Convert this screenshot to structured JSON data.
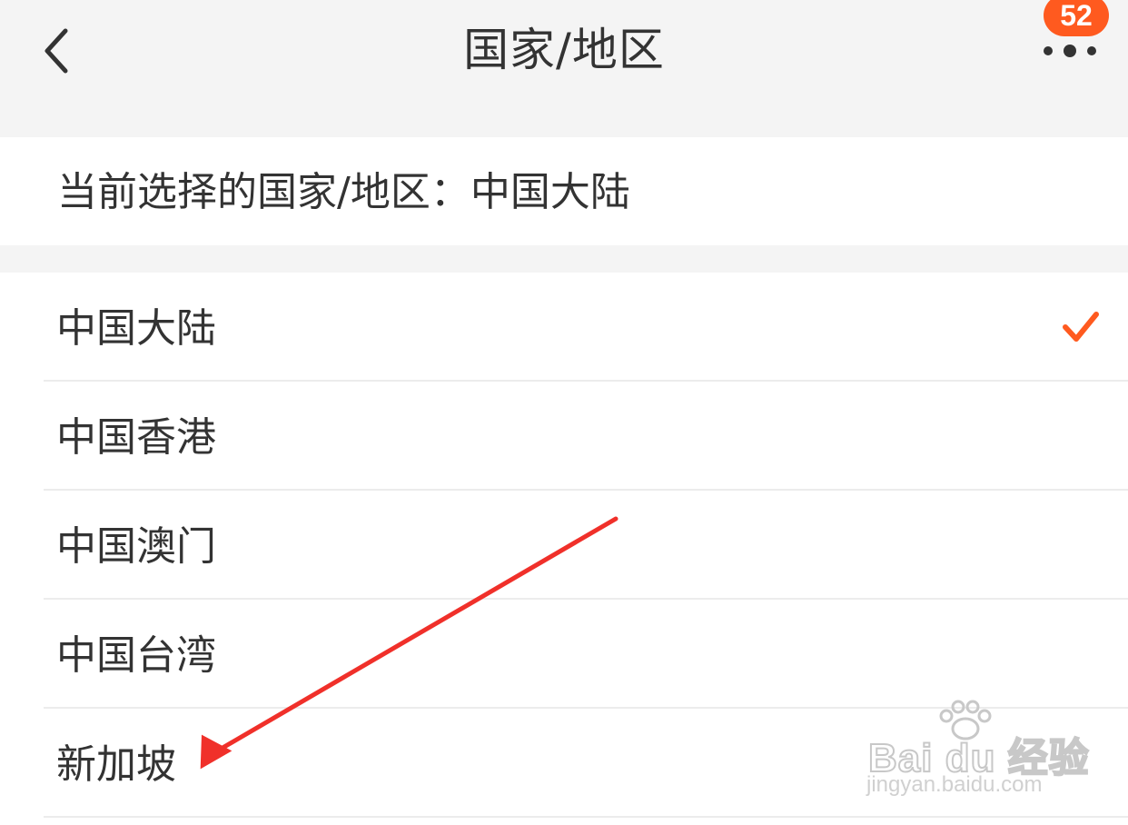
{
  "header": {
    "title": "国家/地区",
    "back_icon": "chevron-left-icon",
    "more_icon": "more-dots-icon",
    "badge_count": "52"
  },
  "current_selection": {
    "text": "当前选择的国家/地区：中国大陆"
  },
  "regions": [
    {
      "label": "中国大陆",
      "selected": true
    },
    {
      "label": "中国香港",
      "selected": false
    },
    {
      "label": "中国澳门",
      "selected": false
    },
    {
      "label": "中国台湾",
      "selected": false
    },
    {
      "label": "新加坡",
      "selected": false
    }
  ],
  "colors": {
    "accent": "#ff5a1f",
    "annotation_arrow": "#f0302a",
    "text": "#333333",
    "background": "#f4f4f4"
  },
  "watermark": {
    "brand": "Bai du 经验",
    "url": "jingyan.baidu.com"
  }
}
